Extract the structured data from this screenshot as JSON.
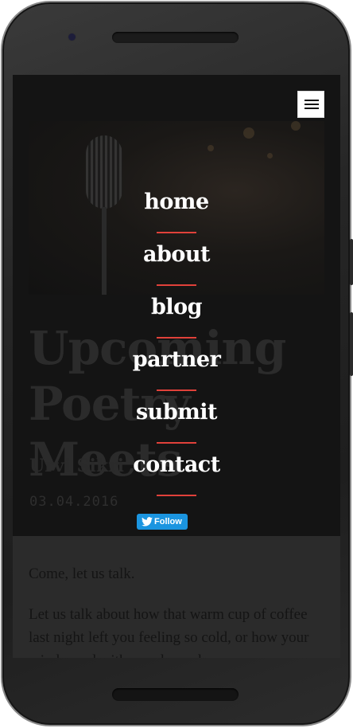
{
  "post": {
    "title": "Upcoming Poetry Meets",
    "author": "Urvi Sikri",
    "date": "03.04.2016",
    "paragraphs": [
      "Come, let us talk.",
      "Let us talk about how that warm cup of coffee last night left you feeling so cold, or how your mind raced with wonder and"
    ]
  },
  "menu": {
    "items": [
      {
        "label": "home"
      },
      {
        "label": "about"
      },
      {
        "label": "blog"
      },
      {
        "label": "partner"
      },
      {
        "label": "submit"
      },
      {
        "label": "contact"
      }
    ],
    "follow_label": "Follow",
    "accent_color": "#e0413a"
  },
  "icons": {
    "menu": "hamburger-icon",
    "follow": "twitter-bird-icon"
  }
}
